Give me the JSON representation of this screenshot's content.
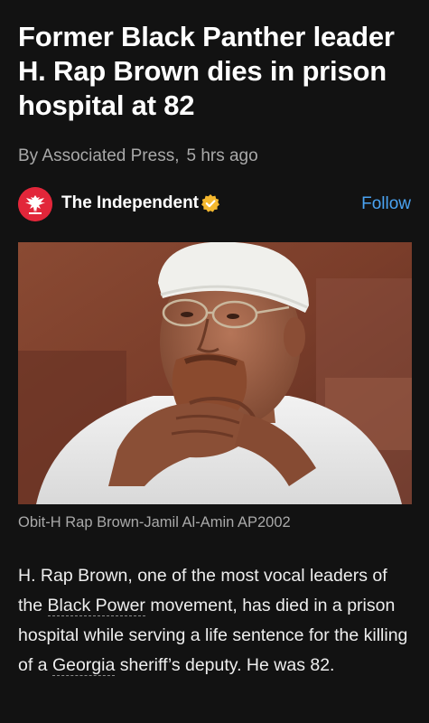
{
  "headline": "Former Black Panther leader H. Rap Brown dies in prison hospital at 82",
  "byline": {
    "author": "By Associated Press,",
    "time": "5 hrs ago"
  },
  "publisher": {
    "name": "The Independent",
    "logo_icon": "eagle-icon",
    "logo_color": "#e2263a",
    "verified_icon": "verified-badge-icon",
    "verified_color": "#f5b82e",
    "follow_label": "Follow",
    "follow_color": "#4aa3f2"
  },
  "photo": {
    "caption": "Obit-H Rap Brown-Jamil Al-Amin AP2002"
  },
  "body": {
    "before_link1": "H. Rap Brown, one of the most vocal leaders of the ",
    "link1": "Black Power",
    "between_links": " movement, has died in a prison hospital while serving a life sentence for the killing of a ",
    "link2": "Georgia",
    "after_link2": " sheriff’s deputy. He was 82."
  }
}
